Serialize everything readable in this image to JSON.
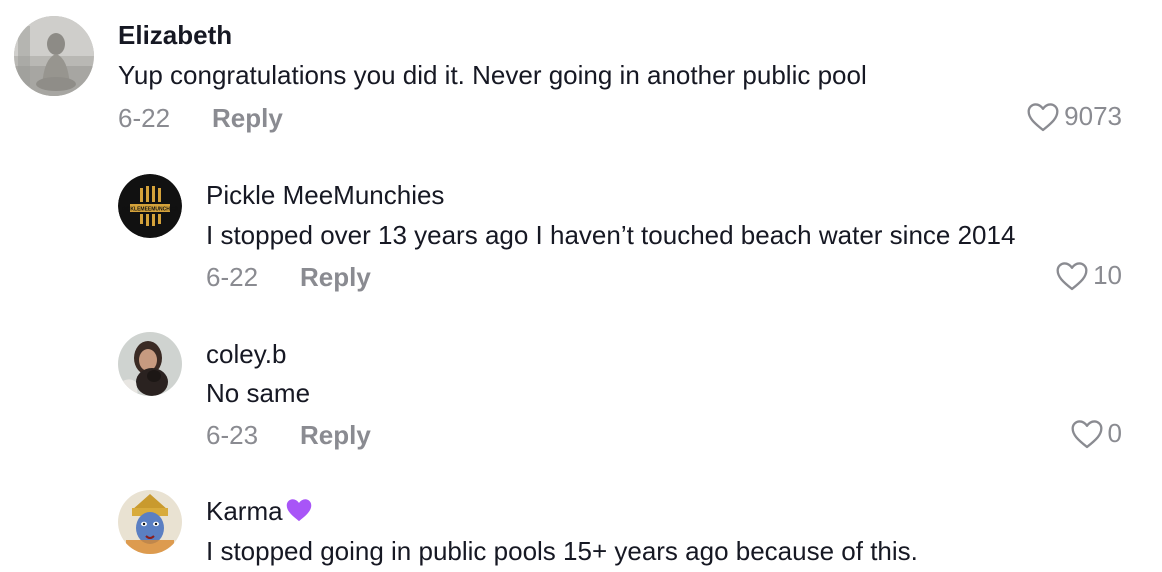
{
  "comments": [
    {
      "username": "Elizabeth",
      "text": "Yup congratulations you did it. Never going in another public pool",
      "date": "6-22",
      "reply_label": "Reply",
      "likes": "9073",
      "avatar": "statue-avatar"
    },
    {
      "username": "Pickle MeeMunchies",
      "text": "I stopped over 13 years ago I haven’t touched beach water since 2014",
      "date": "6-22",
      "reply_label": "Reply",
      "likes": "10",
      "avatar": "logo-avatar",
      "logo_text": "PICKLEMEEMUNCHIES"
    },
    {
      "username": "coley.b",
      "text": "No same",
      "date": "6-23",
      "reply_label": "Reply",
      "likes": "0",
      "avatar": "person-dog-avatar"
    },
    {
      "username": "Karma",
      "username_emoji": "purple-heart-icon",
      "text": "I stopped going in public pools 15+ years ago because of this.",
      "avatar": "deity-avatar"
    }
  ],
  "colors": {
    "text": "#161823",
    "secondary": "#8a8b91",
    "emoji": "#a855f7"
  }
}
